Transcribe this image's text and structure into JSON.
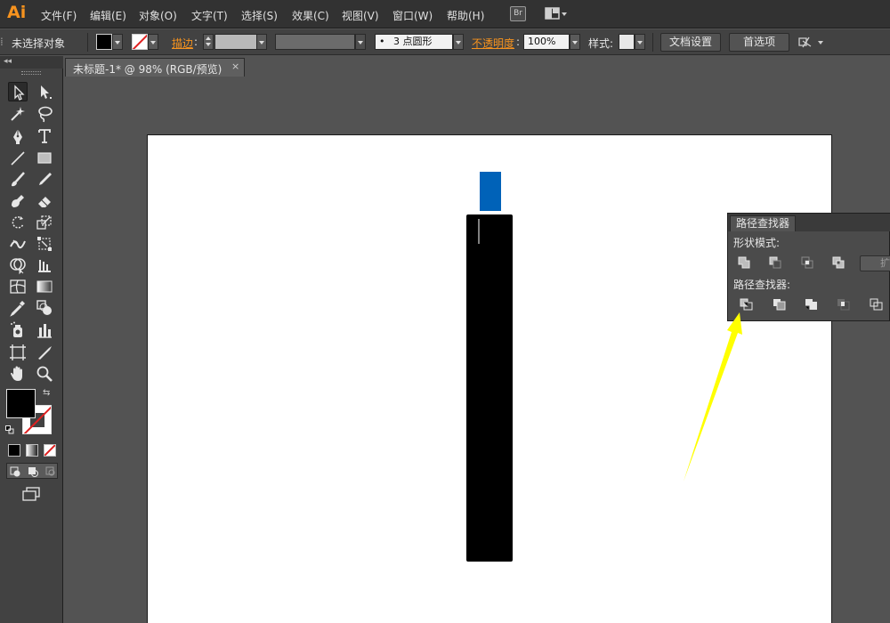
{
  "app": {
    "logo": "Ai",
    "bridge_badge": "Br"
  },
  "menu": [
    "文件(F)",
    "编辑(E)",
    "对象(O)",
    "文字(T)",
    "选择(S)",
    "效果(C)",
    "视图(V)",
    "窗口(W)",
    "帮助(H)"
  ],
  "control_bar": {
    "selection_status": "未选择对象",
    "stroke_label": "描边",
    "stroke_colon": ":",
    "brush_value": "3 点圆形",
    "brush_bullet": "•",
    "opacity_label": "不透明度",
    "opacity_colon": ":",
    "opacity_value": "100%",
    "style_label": "样式:",
    "doc_settings": "文档设置",
    "preferences": "首选项"
  },
  "document": {
    "tab_title": "未标题-1* @ 98% (RGB/预览)",
    "close_glyph": "×"
  },
  "toolbox": {
    "collapse_glyph": "◂◂"
  },
  "artwork": {
    "cap_color": "#0062b8",
    "body_color": "#000000"
  },
  "pathfinder": {
    "tab_title": "路径查找器",
    "shape_modes_label": "形状模式:",
    "pathfinders_label": "路径查找器:",
    "expand_button": "扩展",
    "shape_mode_icons": [
      "unite-icon",
      "minus-front-icon",
      "intersect-icon",
      "exclude-icon"
    ],
    "pathfinder_icons": [
      "divide-icon",
      "trim-icon",
      "merge-icon",
      "crop-icon",
      "outline-icon"
    ]
  },
  "annotation": {
    "arrow_color": "#ffff00"
  },
  "colors": {
    "accent": "#f7931e",
    "stroke_none": "#e02020"
  }
}
